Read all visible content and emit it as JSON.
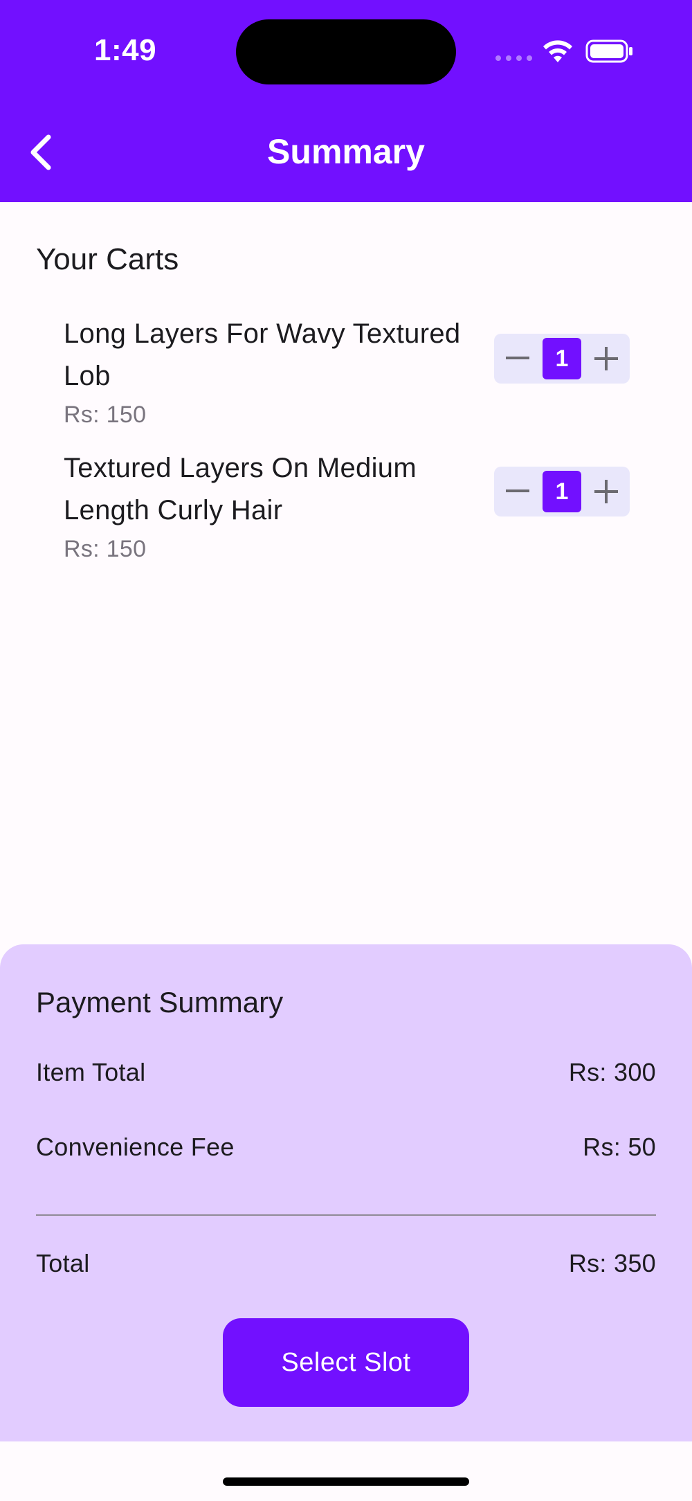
{
  "status_bar": {
    "time": "1:49"
  },
  "header": {
    "title": "Summary",
    "back_icon": "chevron-left-icon"
  },
  "cart": {
    "title": "Your Carts",
    "items": [
      {
        "name": "Long Layers For Wavy Textured Lob",
        "price": "Rs: 150",
        "quantity": "1"
      },
      {
        "name": "Textured Layers On Medium Length Curly Hair",
        "price": "Rs: 150",
        "quantity": "1"
      }
    ]
  },
  "payment": {
    "title": "Payment Summary",
    "item_total_label": "Item Total",
    "item_total_value": "Rs: 300",
    "fee_label": "Convenience Fee",
    "fee_value": "Rs: 50",
    "total_label": "Total",
    "total_value": "Rs: 350",
    "button_label": "Select Slot"
  },
  "colors": {
    "primary": "#7210ff",
    "panel": "#e2ccff",
    "stepper_bg": "#e9e7fb"
  }
}
